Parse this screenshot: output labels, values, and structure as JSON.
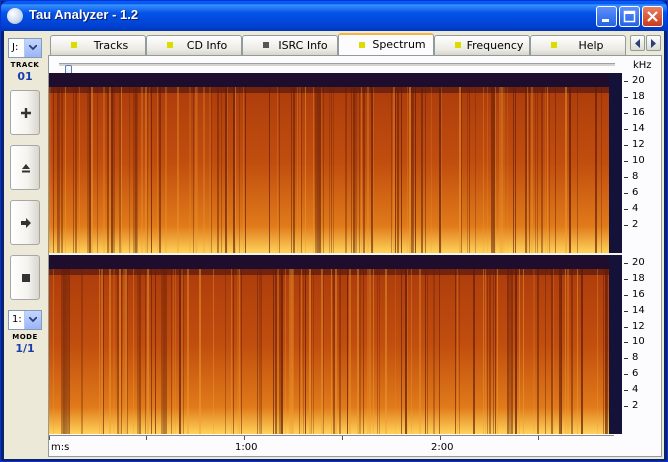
{
  "window": {
    "title": "Tau Analyzer - 1.2"
  },
  "sidebar": {
    "drive_combo": "J:",
    "track_label": "TRACK",
    "track_value": "01",
    "buttons": [
      {
        "name": "add-button",
        "icon": "plus-icon"
      },
      {
        "name": "eject-button",
        "icon": "eject-icon"
      },
      {
        "name": "play-button",
        "icon": "play-arrow-icon"
      },
      {
        "name": "stop-button",
        "icon": "stop-icon"
      }
    ],
    "mode_combo": "1:",
    "mode_label": "MODE",
    "mode_value": "1/1"
  },
  "tabs": [
    {
      "label": "Tracks",
      "led": "#dcdc00",
      "active": false
    },
    {
      "label": "CD Info",
      "led": "#dcdc00",
      "active": false
    },
    {
      "label": "ISRC Info",
      "led": "#555555",
      "active": false
    },
    {
      "label": "Spectrum",
      "led": "#dcdc00",
      "active": true
    },
    {
      "label": "Frequency",
      "led": "#dcdc00",
      "active": false
    },
    {
      "label": "Help",
      "led": "#dcdc00",
      "active": false
    }
  ],
  "spectrum": {
    "frequency_unit": "kHz",
    "frequency_ticks": [
      "20",
      "18",
      "16",
      "14",
      "12",
      "10",
      "8",
      "6",
      "4",
      "2"
    ],
    "time_unit_label": "m:s",
    "time_labels": [
      "1:00",
      "2:00"
    ],
    "channels": 2,
    "colors": {
      "low": "#2a0a3a",
      "mid": "#b8450c",
      "high": "#ffd35a",
      "panel_bg": "#fcfcfe"
    }
  }
}
